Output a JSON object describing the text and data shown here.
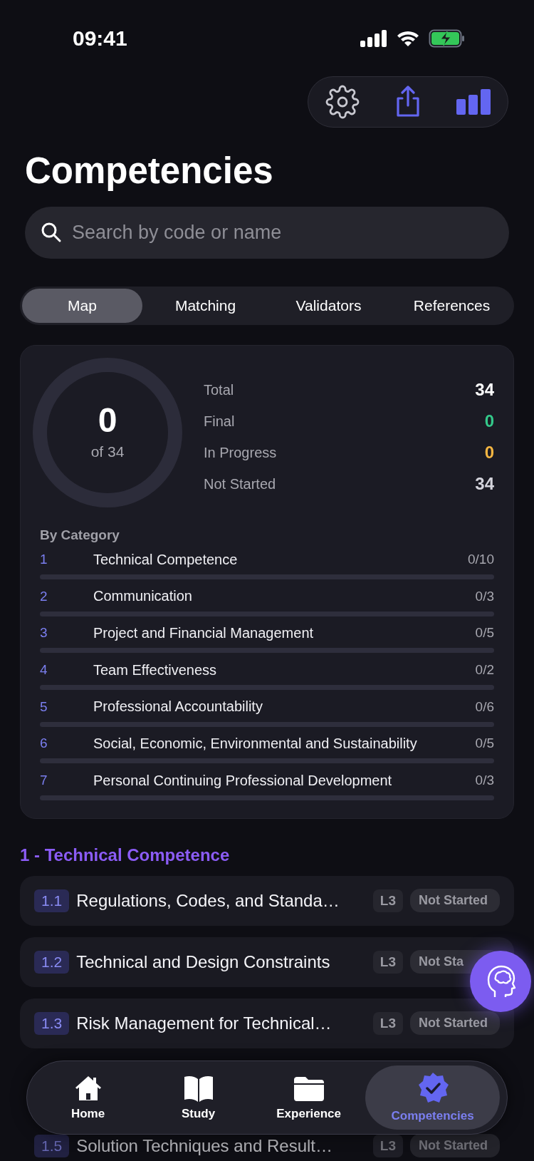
{
  "status_bar": {
    "time": "09:41"
  },
  "title": "Competencies",
  "search": {
    "placeholder": "Search by code or name"
  },
  "tabs": [
    {
      "label": "Map",
      "selected": true
    },
    {
      "label": "Matching",
      "selected": false
    },
    {
      "label": "Validators",
      "selected": false
    },
    {
      "label": "References",
      "selected": false
    }
  ],
  "summary": {
    "ring": {
      "value": "0",
      "caption": "of 34",
      "level": 0
    },
    "stats": [
      {
        "label": "Total",
        "value": "34",
        "color": "#ffffff"
      },
      {
        "label": "Final",
        "value": "0",
        "color": "#34c98a"
      },
      {
        "label": "In Progress",
        "value": "0",
        "color": "#f5b642"
      },
      {
        "label": "Not Started",
        "value": "34",
        "color": "#d4d4dc"
      }
    ],
    "categories_title": "By Category",
    "categories": [
      {
        "number": "1",
        "name": "Technical Competence",
        "count": "0/10",
        "level": 0
      },
      {
        "number": "2",
        "name": "Communication",
        "count": "0/3",
        "level": 0
      },
      {
        "number": "3",
        "name": "Project and Financial Management",
        "count": "0/5",
        "level": 0
      },
      {
        "number": "4",
        "name": "Team Effectiveness",
        "count": "0/2",
        "level": 0
      },
      {
        "number": "5",
        "name": "Professional Accountability",
        "count": "0/6",
        "level": 0
      },
      {
        "number": "6",
        "name": "Social, Economic, Environmental and Sustainability",
        "count": "0/5",
        "level": 0
      },
      {
        "number": "7",
        "name": "Personal Continuing Professional Development",
        "count": "0/3",
        "level": 0
      }
    ]
  },
  "section": {
    "title": "1 - Technical Competence",
    "rows": [
      {
        "code": "1.1",
        "name": "Regulations, Codes, and Standa…",
        "level_tag": "L3",
        "status": "Not Started"
      },
      {
        "code": "1.2",
        "name": "Technical and Design Constraints",
        "level_tag": "L3",
        "status": "Not Sta"
      },
      {
        "code": "1.3",
        "name": "Risk Management for Technical…",
        "level_tag": "L3",
        "status": "Not Started"
      },
      {
        "code": "1.5",
        "name": "Solution Techniques and Result…",
        "level_tag": "L3",
        "status": "Not Started"
      }
    ]
  },
  "nav": [
    {
      "label": "Home",
      "selected": false
    },
    {
      "label": "Study",
      "selected": false
    },
    {
      "label": "Experience",
      "selected": false
    },
    {
      "label": "Competencies",
      "selected": true
    }
  ]
}
